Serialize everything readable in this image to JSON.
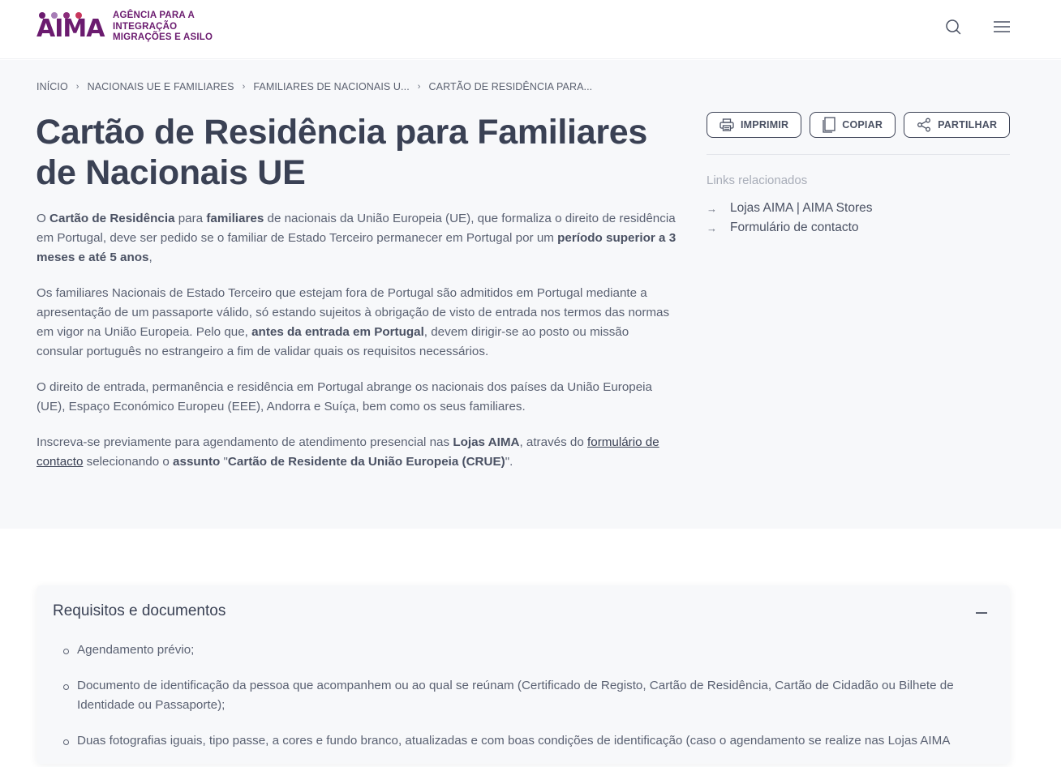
{
  "header": {
    "logo_word": "AIMA",
    "logo_line1": "Agência para a",
    "logo_line2": "Integração",
    "logo_line3": "Migrações e Asilo",
    "logo_dot_colors": [
      "#6b1b6f",
      "#a77db6",
      "#8a2c7a",
      "#c8365c"
    ],
    "icons": [
      "search-icon",
      "menu-icon"
    ]
  },
  "breadcrumb": {
    "items": [
      "INÍCIO",
      "NACIONAIS UE E FAMILIARES",
      "FAMILIARES DE NACIONAIS U...",
      "CARTÃO DE RESIDÊNCIA PARA..."
    ],
    "separator": "›"
  },
  "page": {
    "title": "Cartão de Residência para Familiares de Nacionais UE",
    "p1": {
      "t1": "O ",
      "b1": "Cartão de Residência",
      "t2": " para ",
      "b2": "familiares",
      "t3": " de nacionais da União Europeia (UE), que formaliza o direito de residência em Portugal, deve ser pedido se o familiar de Estado Terceiro permanecer em Portugal por um ",
      "b3": "período superior a 3 meses e até 5 anos",
      "t4": ","
    },
    "p2": {
      "t1": "Os familiares Nacionais de Estado Terceiro que estejam fora de Portugal são admitidos em Portugal mediante a apresentação de um passaporte válido, só estando sujeitos à obrigação de visto de entrada nos termos das normas em vigor na União Europeia. Pelo que, ",
      "b1": "antes da entrada em Portugal",
      "t2": ", devem dirigir-se ao posto ou missão consular português no estrangeiro a fim de validar quais os requisitos necessários."
    },
    "p3": "O direito de entrada, permanência e residência em Portugal abrange os nacionais dos países da União Europeia (UE), Espaço Económico Europeu (EEE), Andorra e Suíça, bem como os seus familiares.",
    "p4": {
      "t1": "Inscreva-se previamente para agendamento de atendimento presencial nas ",
      "b1": "Lojas AIMA",
      "t2": ", através do ",
      "link": "formulário de contacto",
      "t3": " selecionando o ",
      "b2": "assunto",
      "t4": " \"",
      "b3": "Cartão de Residente da União Europeia (CRUE)",
      "t5": "\"."
    }
  },
  "actions": {
    "print": "IMPRIMIR",
    "copy": "COPIAR",
    "share": "PARTILHAR"
  },
  "related": {
    "title": "Links relacionados",
    "items": [
      "Lojas AIMA | AIMA Stores",
      "Formulário de contacto"
    ]
  },
  "accordion": {
    "title": "Requisitos e documentos",
    "items": [
      "Agendamento prévio;",
      "Documento de identificação da pessoa que acompanhem ou ao qual se reúnam (Certificado de Registo, Cartão de Residência, Cartão de Cidadão ou Bilhete de Identidade ou Passaporte);",
      "Duas fotografias iguais, tipo passe, a cores e fundo branco, atualizadas e com boas condições de identificação (caso o agendamento se realize nas Lojas AIMA"
    ]
  }
}
